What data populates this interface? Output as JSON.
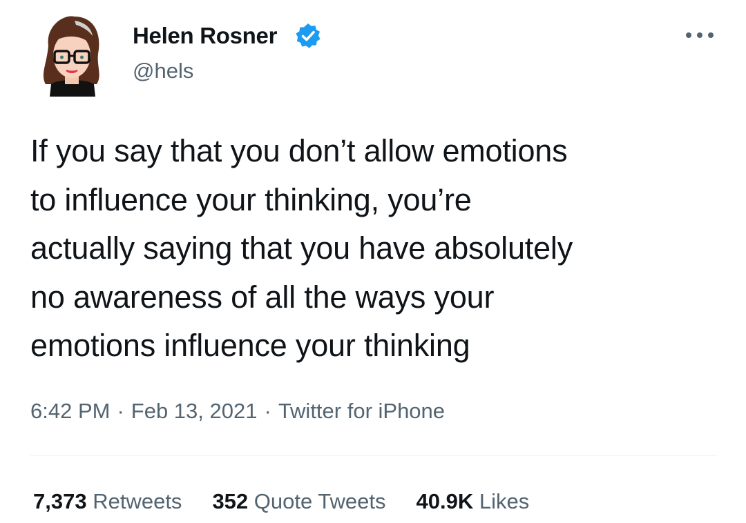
{
  "tweet": {
    "author": {
      "name": "Helen Rosner",
      "handle": "@hels",
      "verified": true,
      "avatar_icon": "cartoon-avatar-icon"
    },
    "text": [
      "If you say that you don’t allow emotions",
      "to influence your thinking, you’re",
      "actually saying that you have absolutely",
      "no awareness of all the ways your",
      "emotions influence your thinking"
    ],
    "meta": {
      "time": "6:42 PM",
      "date": "Feb 13, 2021",
      "separator": "·",
      "source": "Twitter for iPhone"
    },
    "stats": [
      {
        "count": "7,373",
        "label": "Retweets"
      },
      {
        "count": "352",
        "label": "Quote Tweets"
      },
      {
        "count": "40.9K",
        "label": "Likes"
      }
    ]
  },
  "colors": {
    "text": "#0f1419",
    "secondary": "#536471",
    "verified_blue": "#1d9bf0",
    "divider": "#eff3f4"
  }
}
